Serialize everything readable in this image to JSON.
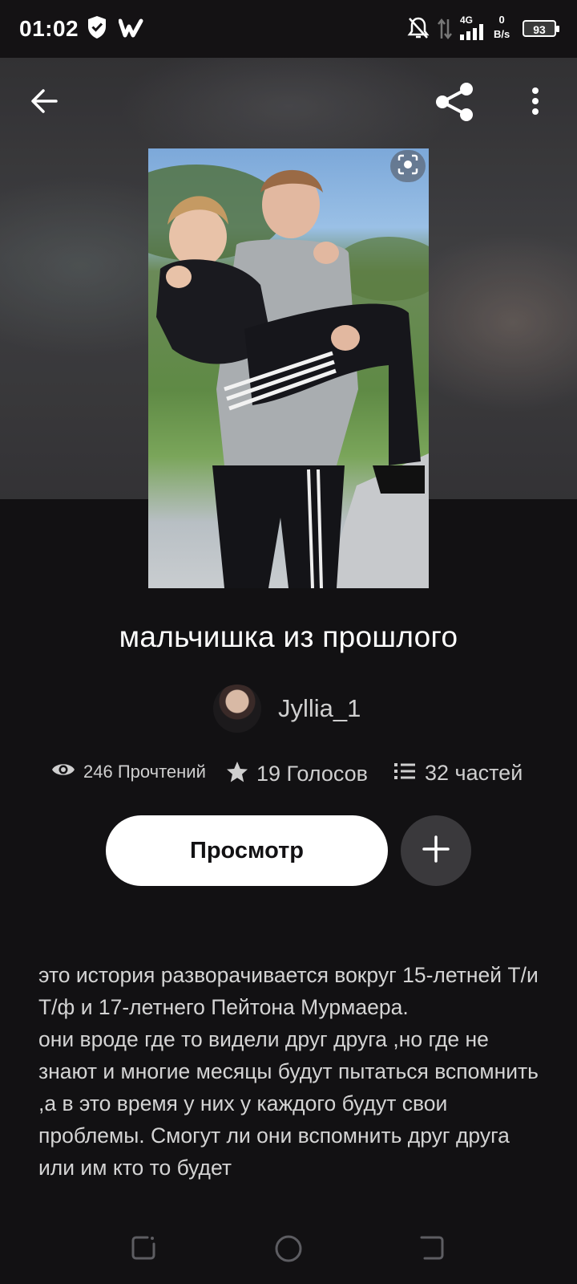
{
  "status_bar": {
    "time": "01:02",
    "network": "4G",
    "net_speed_value": "0",
    "net_speed_unit": "B/s",
    "battery": "93",
    "icons": [
      "shield-check-icon",
      "wattpad-logo-icon",
      "bell-off-icon",
      "data-arrows-icon",
      "signal-icon",
      "battery-icon"
    ]
  },
  "toolbar": {
    "icons": [
      "back-arrow-icon",
      "share-icon",
      "more-vertical-icon"
    ]
  },
  "story": {
    "title": "мальчишка из прошлого",
    "author": "Jyllia_1",
    "stats": {
      "reads": "246 Прочтений",
      "votes": "19 Голосов",
      "parts": "32 частей"
    },
    "read_button": "Просмотр",
    "description": "это история разворачивается вокруг 15-летней Т/и Т/ф и 17-летнего Пейтона Мурмаера.\nони вроде где то видели друг друга ,но где не знают и многие месяцы будут пытаться вспомнить ,а в это время у них у каждого будут свои проблемы. Смогут ли они вспомнить друг друга или им кто то будет"
  },
  "nav_bar": {
    "icons": [
      "recents-icon",
      "home-icon",
      "back-icon"
    ]
  },
  "colors": {
    "background": "#121113",
    "button_primary": "#ffffff",
    "button_secondary": "#3a393c",
    "text_secondary": "#cfcfcf"
  }
}
